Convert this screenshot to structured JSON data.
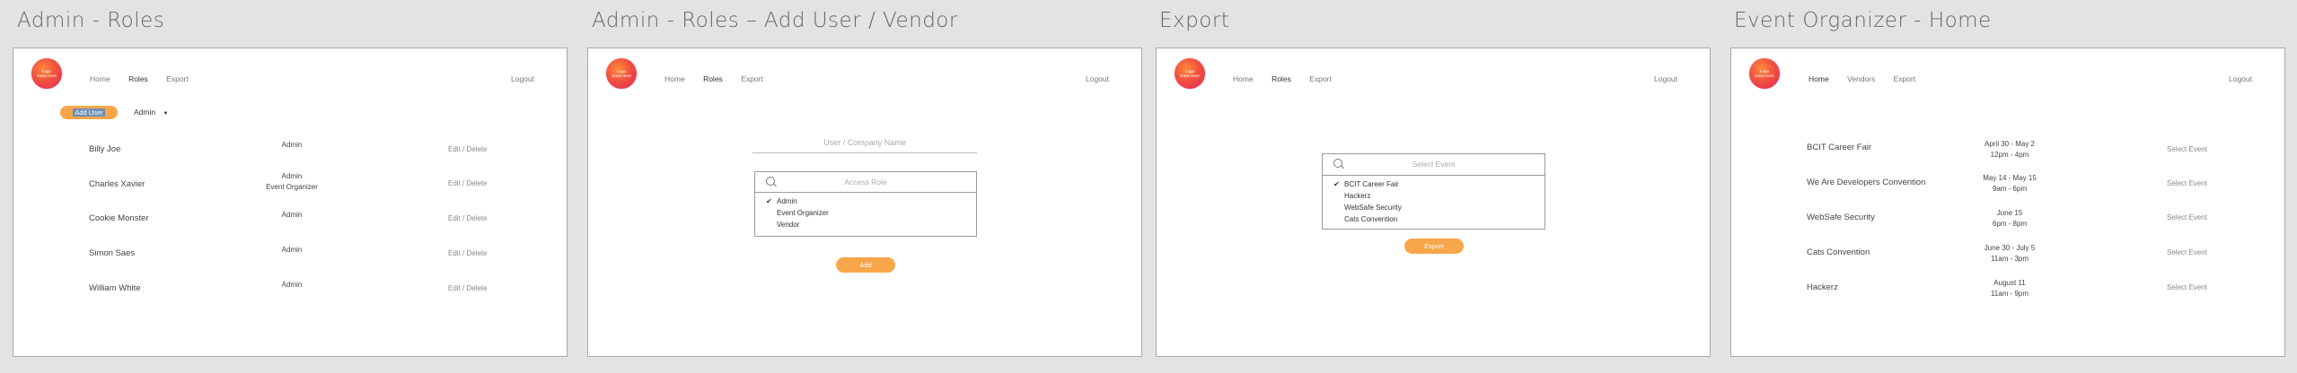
{
  "logo_text": "Logo Goes Here",
  "panels": [
    {
      "title": "Admin - Roles",
      "nav": [
        "Home",
        "Roles",
        "Export"
      ],
      "active_nav": "Roles",
      "logout": "Logout",
      "add_user_button": "Add User",
      "role_filter": "Admin",
      "rows": [
        {
          "name": "Billy Joe",
          "role": "Admin",
          "actions": "Edit  /  Delete"
        },
        {
          "name": "Charles Xavier",
          "role": "Admin\nEvent Organizer",
          "actions": "Edit  /  Delete"
        },
        {
          "name": "Cookie Monster",
          "role": "Admin",
          "actions": "Edit  /  Delete"
        },
        {
          "name": "Simon Saes",
          "role": "Admin",
          "actions": "Edit  /  Delete"
        },
        {
          "name": "William White",
          "role": "Admin",
          "actions": "Edit  /  Delete"
        }
      ]
    },
    {
      "title": "Admin - Roles – Add User / Vendor",
      "nav": [
        "Home",
        "Roles",
        "Export"
      ],
      "active_nav": "Roles",
      "logout": "Logout",
      "name_placeholder": "User / Company Name",
      "role_placeholder": "Access Role",
      "roles": [
        "Admin",
        "Event Organizer",
        "Vendor"
      ],
      "checked_role": "Admin",
      "add_button": "Add"
    },
    {
      "title": "Export",
      "nav": [
        "Home",
        "Roles",
        "Export"
      ],
      "active_nav": "Roles",
      "logout": "Logout",
      "event_placeholder": "Select Event",
      "events": [
        "BCIT Career Fair",
        "Hackerz",
        "WebSafe Security",
        "Cats Convention"
      ],
      "checked_event": "BCIT Career Fair",
      "export_button": "Export"
    },
    {
      "title": "Event Organizer - Home",
      "nav": [
        "Home",
        "Vendors",
        "Export"
      ],
      "active_nav": "Home",
      "logout": "Logout",
      "rows": [
        {
          "name": "BCIT Career Fair",
          "date": "April 30 - May 2\n12pm - 4pm",
          "action": "Select Event"
        },
        {
          "name": "We Are Developers Convention",
          "date": "May 14 - May 15\n9am - 6pm",
          "action": "Select Event"
        },
        {
          "name": "WebSafe Security",
          "date": "June 15\n6pm - 8pm",
          "action": "Select Event"
        },
        {
          "name": "Cats Convention",
          "date": "June 30 - July 5\n11am - 3pm",
          "action": "Select Event"
        },
        {
          "name": "Hackerz",
          "date": "August 11\n11am - 9pm",
          "action": "Select Event"
        }
      ]
    }
  ]
}
